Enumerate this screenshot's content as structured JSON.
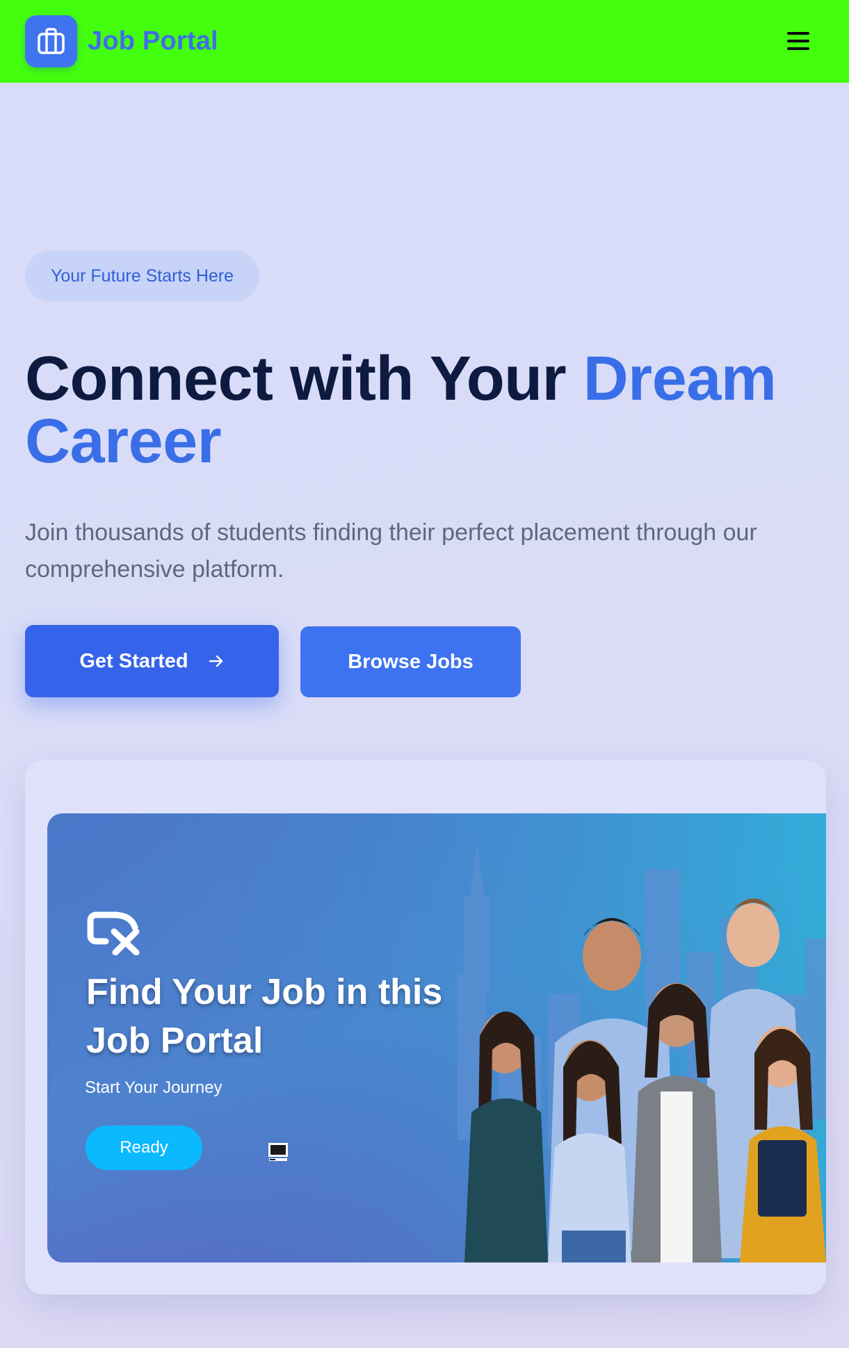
{
  "header": {
    "brand": "Job Portal",
    "logo_icon": "briefcase-icon",
    "menu_icon": "hamburger-menu-icon",
    "background_color": "#43ff0e",
    "brand_color": "#3f6fe8"
  },
  "hero": {
    "badge": "Your Future Starts Here",
    "headline_main": "Connect with Your",
    "headline_accent": "Dream Career",
    "subtitle": "Join thousands of students finding their perfect placement through our comprehensive platform.",
    "primary_button": "Get Started",
    "primary_button_icon": "arrow-right-icon",
    "secondary_button": "Browse Jobs",
    "accent_color": "#3a6ee8"
  },
  "banner": {
    "title": "Find Your Job in this Job Portal",
    "subtitle": "Start Your Journey",
    "button": "Ready",
    "button_color": "#0bb9ff",
    "logo_icon": "job-search-logo-icon",
    "extra_icon": "monitor-icon",
    "image": "group-of-young-professionals-city-skyline"
  }
}
